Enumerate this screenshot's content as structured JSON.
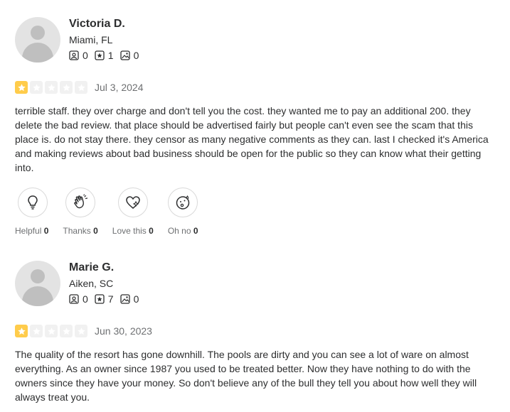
{
  "reviews": [
    {
      "user": {
        "name": "Victoria D.",
        "location": "Miami, FL",
        "reviews_count": "0",
        "photos_friends": "1",
        "photos_count": "0"
      },
      "rating": 1,
      "date": "Jul 3, 2024",
      "text": "terrible staff. they over charge and don't tell you the cost. they wanted me to pay an additional 200. they delete the bad review. that place should be advertised fairly but people can't even see the scam that this place is. do not stay there. they censor as many negative comments as they can. last I checked it's America and making reviews about bad business should be open for the public so they can know what their getting into.",
      "reactions": [
        {
          "label": "Helpful",
          "count": "0",
          "icon": "lightbulb-icon"
        },
        {
          "label": "Thanks",
          "count": "0",
          "icon": "clapping-hand-icon"
        },
        {
          "label": "Love this",
          "count": "0",
          "icon": "heart-icon"
        },
        {
          "label": "Oh no",
          "count": "0",
          "icon": "surprised-face-icon"
        }
      ]
    },
    {
      "user": {
        "name": "Marie G.",
        "location": "Aiken, SC",
        "reviews_count": "0",
        "photos_friends": "7",
        "photos_count": "0"
      },
      "rating": 1,
      "date": "Jun 30, 2023",
      "text": "The quality of the resort has gone downhill. The pools are dirty and you can see a lot of ware on almost everything. As an owner since 1987 you used to be treated better. Now they have nothing to do with the owners since they have your money. So don't believe any of the bull they tell you about how well they will always treat you."
    }
  ],
  "colors": {
    "star_filled": "#ffcc4b",
    "star_empty": "#f1f1f1",
    "text": "#2d2e2f",
    "muted": "#6e7072"
  }
}
